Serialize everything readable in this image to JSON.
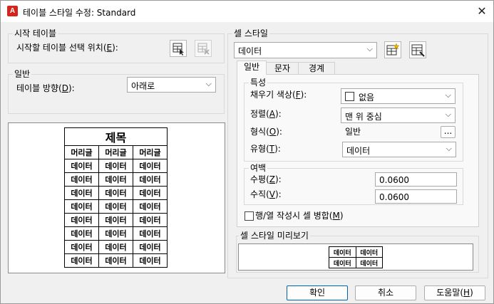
{
  "dialog": {
    "app_icon": "A",
    "title": "테이블 스타일 수정: Standard",
    "close_glyph": "✕"
  },
  "start_table": {
    "group_label": "시작 테이블",
    "select_label": "시작할 테이블 선택 위치(",
    "select_hotkey": "E",
    "select_suffix": "):",
    "select_icon": "table-select-icon",
    "remove_icon": "table-remove-icon"
  },
  "general": {
    "group_label": "일반",
    "direction_label": "테이블 방향(",
    "direction_hotkey": "D",
    "direction_suffix": "):",
    "direction_value": "아래로"
  },
  "table_preview": {
    "title": "제목",
    "headers": [
      "머리글",
      "머리글",
      "머리글"
    ],
    "rows": [
      [
        "데이터",
        "데이터",
        "데이터"
      ],
      [
        "데이터",
        "데이터",
        "데이터"
      ],
      [
        "데이터",
        "데이터",
        "데이터"
      ],
      [
        "데이터",
        "데이터",
        "데이터"
      ],
      [
        "데이터",
        "데이터",
        "데이터"
      ],
      [
        "데이터",
        "데이터",
        "데이터"
      ],
      [
        "데이터",
        "데이터",
        "데이터"
      ],
      [
        "데이터",
        "데이터",
        "데이터"
      ]
    ]
  },
  "cell_style": {
    "group_label": "셀 스타일",
    "selected": "데이터",
    "new_style_icon": "new-cell-style-icon",
    "manage_style_icon": "manage-cell-styles-icon",
    "tabs": [
      "일반",
      "문자",
      "경계"
    ],
    "active_tab": 0,
    "properties": {
      "group_label": "특성",
      "fill_label": "채우기 색상(",
      "fill_hotkey": "F",
      "fill_suffix": "):",
      "fill_value": "없음",
      "align_label": "정렬(",
      "align_hotkey": "A",
      "align_suffix": "):",
      "align_value": "맨 위 중심",
      "format_label": "형식(",
      "format_hotkey": "O",
      "format_suffix": "):",
      "format_value": "일반",
      "format_button": "...",
      "type_label": "유형(",
      "type_hotkey": "T",
      "type_suffix": "):",
      "type_value": "데이터"
    },
    "margins": {
      "group_label": "여백",
      "horizontal_label": "수평(",
      "horizontal_hotkey": "Z",
      "horizontal_suffix": "):",
      "horizontal_value": "0.0600",
      "vertical_label": "수직(",
      "vertical_hotkey": "V",
      "vertical_suffix": "):",
      "vertical_value": "0.0600"
    },
    "merge_label": "행/열 작성시 셀 병합(",
    "merge_hotkey": "M",
    "merge_suffix": ")",
    "merge_checked": false
  },
  "cell_preview": {
    "group_label": "셀 스타일 미리보기",
    "cells": [
      [
        "데이터",
        "데이터"
      ],
      [
        "데이터",
        "데이터"
      ]
    ]
  },
  "buttons": {
    "ok": "확인",
    "cancel": "취소",
    "help_prefix": "도움말(",
    "help_hotkey": "H",
    "help_suffix": ")"
  }
}
